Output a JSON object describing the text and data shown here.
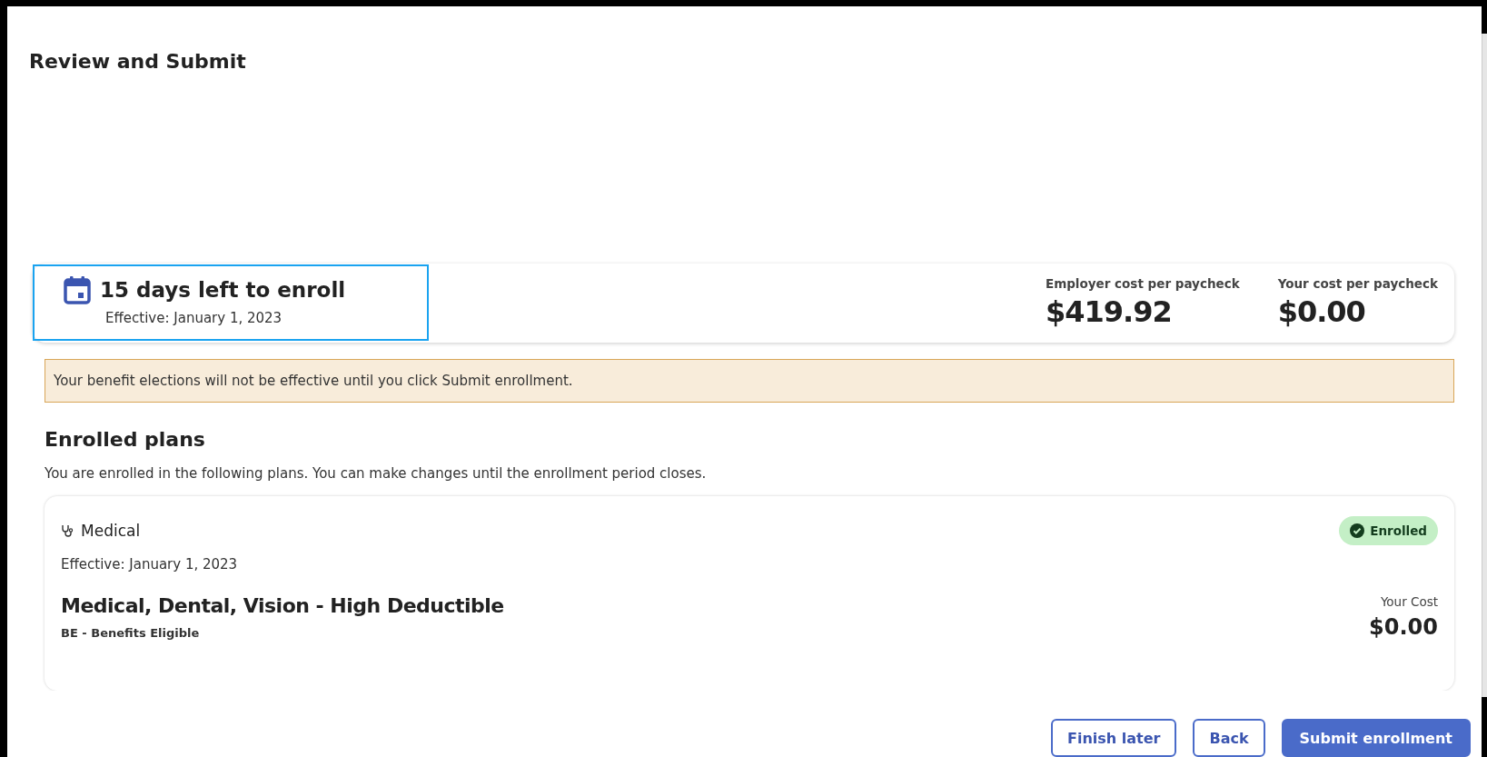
{
  "page": {
    "title": "Review and Submit"
  },
  "enrollment_summary": {
    "deadline": "15 days left to enroll",
    "effective": "Effective: January 1, 2023",
    "highlighted": true,
    "costs": [
      {
        "label": "Employer cost per paycheck",
        "value": "$419.92"
      },
      {
        "label": "Your cost per paycheck",
        "value": "$0.00"
      }
    ]
  },
  "alert": {
    "message": "Your benefit elections will not be effective until you click Submit enrollment."
  },
  "enrolled_plans": {
    "heading": "Enrolled plans",
    "description": "You are enrolled in the following plans. You can make changes until the enrollment period closes.",
    "plans": [
      {
        "category": "Medical",
        "status": "Enrolled",
        "enrolled": true,
        "effective": "Effective: January 1, 2023",
        "plan_name": "Medical, Dental, Vision - High Deductible",
        "eligibility": "BE - Benefits Eligible",
        "cost_label": "Your Cost",
        "cost": "$0.00"
      }
    ]
  },
  "footer_buttons": [
    {
      "label": "Finish later",
      "kind": "secondary"
    },
    {
      "label": "Back",
      "kind": "secondary"
    },
    {
      "label": "Submit enrollment",
      "kind": "primary"
    }
  ]
}
